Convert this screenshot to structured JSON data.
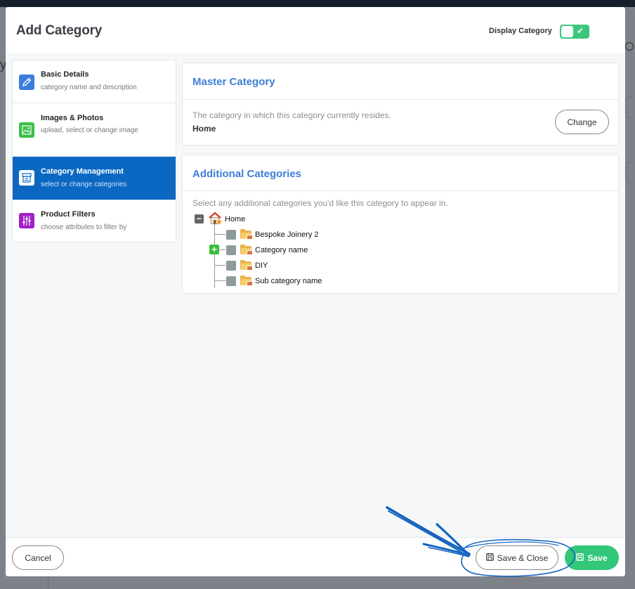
{
  "modal": {
    "title": "Add Category",
    "display_category_label": "Display Category",
    "display_category_on": true
  },
  "nav": {
    "items": [
      {
        "title": "Basic Details",
        "subtitle": "category name and description",
        "icon": "pencil-icon",
        "color": "#3b7ddd",
        "active": false
      },
      {
        "title": "Images & Photos",
        "subtitle": "upload, select or change image",
        "icon": "image-icon",
        "color": "#3cc04a",
        "active": false
      },
      {
        "title": "Category Management",
        "subtitle": "select or change categories",
        "icon": "archive-icon",
        "color": "#ffffff",
        "active": true
      },
      {
        "title": "Product Filters",
        "subtitle": "choose attributes to filter by",
        "icon": "filter-sliders-icon",
        "color": "#a21fc9",
        "active": false
      }
    ]
  },
  "master": {
    "title": "Master Category",
    "description": "The category in which this category currently resides.",
    "value": "Home",
    "change_label": "Change"
  },
  "additional": {
    "title": "Additional Categories",
    "description": "Select any additional categories you'd like this category to appear in.",
    "tree": {
      "root": "Home",
      "children": [
        "Bespoke Joinery 2",
        "Category name",
        "DIY",
        "Sub category name"
      ]
    }
  },
  "footer": {
    "cancel_label": "Cancel",
    "save_close_label": "Save & Close",
    "save_label": "Save"
  },
  "colors": {
    "accent_blue": "#3e7ed6",
    "active_nav": "#0b68c2",
    "save_green": "#33c77a",
    "annotation_blue": "#1565c0"
  }
}
